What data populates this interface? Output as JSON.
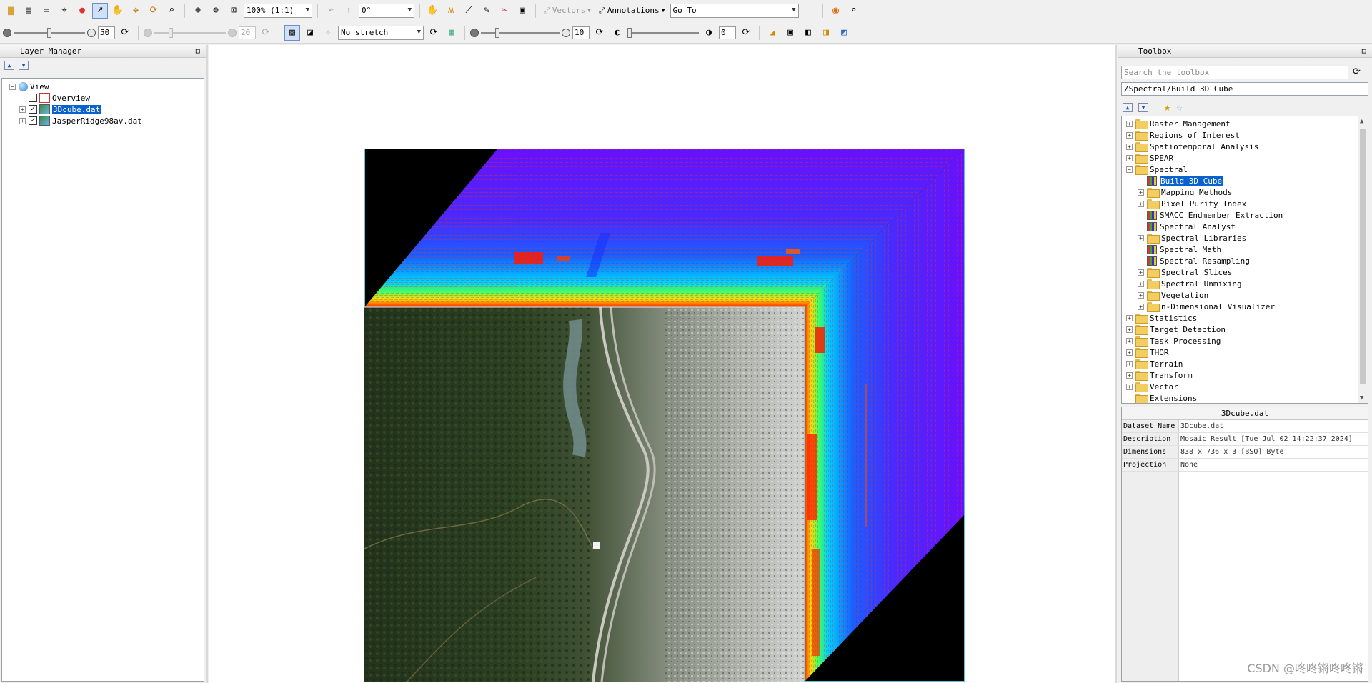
{
  "toolbar1": {
    "zoom_value": "100% (1:1)",
    "rotation_value": "0°",
    "vectors_label": "Vectors",
    "annotations_label": "Annotations",
    "goto_value": "Go To"
  },
  "toolbar2": {
    "brightness_value": "50",
    "brightness_level": 0.5,
    "contrast_value": "20",
    "stretch_value": "No stretch",
    "sharpen_value": "10",
    "transparency_value": "0"
  },
  "layer_manager": {
    "title": "Layer Manager",
    "root_label": "View",
    "items": [
      {
        "label": "Overview",
        "checked": false,
        "selected": false
      },
      {
        "label": "3Dcube.dat",
        "checked": true,
        "selected": true
      },
      {
        "label": "JasperRidge98av.dat",
        "checked": true,
        "selected": false
      }
    ]
  },
  "toolbox": {
    "title": "Toolbox",
    "search_placeholder": "Search the toolbox",
    "path": "/Spectral/Build 3D Cube",
    "tree": [
      {
        "label": "Raster Management",
        "type": "folder",
        "level": 0,
        "expander": "+"
      },
      {
        "label": "Regions of Interest",
        "type": "folder",
        "level": 0,
        "expander": "+"
      },
      {
        "label": "Spatiotemporal Analysis",
        "type": "folder",
        "level": 0,
        "expander": "+"
      },
      {
        "label": "SPEAR",
        "type": "folder",
        "level": 0,
        "expander": "+"
      },
      {
        "label": "Spectral",
        "type": "folder",
        "level": 0,
        "expander": "-"
      },
      {
        "label": "Build 3D Cube",
        "type": "tool",
        "level": 1,
        "selected": true
      },
      {
        "label": "Mapping Methods",
        "type": "folder",
        "level": 1,
        "expander": "+"
      },
      {
        "label": "Pixel Purity Index",
        "type": "folder",
        "level": 1,
        "expander": "+"
      },
      {
        "label": "SMACC Endmember Extraction",
        "type": "tool",
        "level": 1
      },
      {
        "label": "Spectral Analyst",
        "type": "tool",
        "level": 1
      },
      {
        "label": "Spectral Libraries",
        "type": "folder",
        "level": 1,
        "expander": "+"
      },
      {
        "label": "Spectral Math",
        "type": "tool",
        "level": 1
      },
      {
        "label": "Spectral Resampling",
        "type": "tool",
        "level": 1
      },
      {
        "label": "Spectral Slices",
        "type": "folder",
        "level": 1,
        "expander": "+"
      },
      {
        "label": "Spectral Unmixing",
        "type": "folder",
        "level": 1,
        "expander": "+"
      },
      {
        "label": "Vegetation",
        "type": "folder",
        "level": 1,
        "expander": "+"
      },
      {
        "label": "n-Dimensional Visualizer",
        "type": "folder",
        "level": 1,
        "expander": "+"
      },
      {
        "label": "Statistics",
        "type": "folder",
        "level": 0,
        "expander": "+"
      },
      {
        "label": "Target Detection",
        "type": "folder",
        "level": 0,
        "expander": "+"
      },
      {
        "label": "Task Processing",
        "type": "folder",
        "level": 0,
        "expander": "+"
      },
      {
        "label": "THOR",
        "type": "folder",
        "level": 0,
        "expander": "+"
      },
      {
        "label": "Terrain",
        "type": "folder",
        "level": 0,
        "expander": "+"
      },
      {
        "label": "Transform",
        "type": "folder",
        "level": 0,
        "expander": "+"
      },
      {
        "label": "Vector",
        "type": "folder",
        "level": 0,
        "expander": "+"
      },
      {
        "label": "Extensions",
        "type": "folder",
        "level": 0,
        "expander": ""
      }
    ]
  },
  "properties": {
    "title": "3Dcube.dat",
    "rows": [
      {
        "key": "Dataset Name",
        "value": "3Dcube.dat"
      },
      {
        "key": "Description",
        "value": "Mosaic Result [Tue Jul 02 14:22:37 2024]"
      },
      {
        "key": "Dimensions",
        "value": "838 x 736 x 3 [BSQ] Byte"
      },
      {
        "key": "Projection",
        "value": "None"
      }
    ]
  },
  "watermark": "CSDN @咚咚锵咚咚锵",
  "colors": {
    "selection": "#0a62cc",
    "cube_border": "#58c8d8",
    "spectral_low": "#6b10ff",
    "spectral_high": "#ff1a00"
  }
}
